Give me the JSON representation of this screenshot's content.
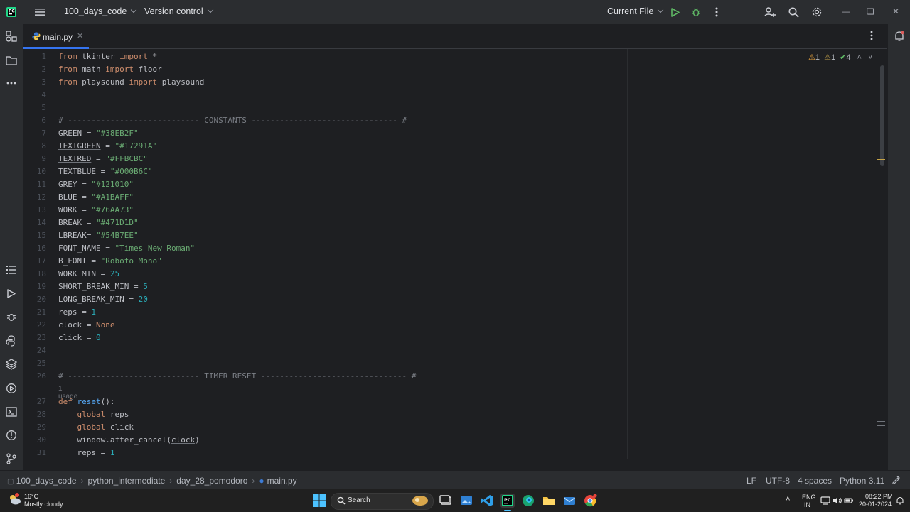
{
  "titlebar": {
    "project": "100_days_code",
    "vcs": "Version control",
    "run_config": "Current File"
  },
  "tab": {
    "label": "main.py"
  },
  "inspections": {
    "warnings_a": "1",
    "warnings_b": "1",
    "ok": "4"
  },
  "editor": {
    "line_numbers": [
      "1",
      "2",
      "3",
      "4",
      "5",
      "6",
      "7",
      "8",
      "9",
      "10",
      "11",
      "12",
      "13",
      "14",
      "15",
      "16",
      "17",
      "18",
      "19",
      "20",
      "21",
      "22",
      "23",
      "24",
      "25",
      "26",
      "27",
      "28",
      "29",
      "30",
      "31"
    ],
    "usage_hint": "1 usage",
    "code": {
      "l1_a": "from",
      "l1_b": " tkinter ",
      "l1_c": "import",
      "l1_d": " *",
      "l2_a": "from",
      "l2_b": " math ",
      "l2_c": "import",
      "l2_d": " floor",
      "l3_a": "from",
      "l3_b": " playsound ",
      "l3_c": "import",
      "l3_d": " playsound",
      "l6": "# ---------------------------- CONSTANTS ------------------------------- #",
      "l7_a": "GREEN = ",
      "l7_b": "\"#38EB2F\"",
      "l8_a": "TEXTGREEN",
      "l8_b": " = ",
      "l8_c": "\"#17291A\"",
      "l9_a": "TEXTRED",
      "l9_b": " = ",
      "l9_c": "\"#FFBCBC\"",
      "l10_a": "TEXTBLUE",
      "l10_b": " = ",
      "l10_c": "\"#000B6C\"",
      "l11_a": "GREY = ",
      "l11_b": "\"#121010\"",
      "l12_a": "BLUE = ",
      "l12_b": "\"#A1BAFF\"",
      "l13_a": "WORK = ",
      "l13_b": "\"#76AA73\"",
      "l14_a": "BREAK = ",
      "l14_b": "\"#471D1D\"",
      "l15_a": "LBREAK",
      "l15_b": "= ",
      "l15_c": "\"#54B7EE\"",
      "l16_a": "FONT_NAME = ",
      "l16_b": "\"Times New Roman\"",
      "l17_a": "B_FONT = ",
      "l17_b": "\"Roboto Mono\"",
      "l18_a": "WORK_MIN = ",
      "l18_b": "25",
      "l19_a": "SHORT_BREAK_MIN = ",
      "l19_b": "5",
      "l20_a": "LONG_BREAK_MIN = ",
      "l20_b": "20",
      "l21_a": "reps = ",
      "l21_b": "1",
      "l22_a": "clock = ",
      "l22_b": "None",
      "l23_a": "click = ",
      "l23_b": "0",
      "l26": "# ---------------------------- TIMER RESET ------------------------------- #",
      "l27_a": "def",
      "l27_b": " reset",
      "l27_c": "():",
      "l28_a": "    ",
      "l28_b": "global",
      "l28_c": " reps",
      "l29_a": "    ",
      "l29_b": "global",
      "l29_c": " click",
      "l30_a": "    window.after_cancel(",
      "l30_b": "clock",
      "l30_c": ")",
      "l31_a": "    reps = ",
      "l31_b": "1"
    }
  },
  "statusbar": {
    "crumbs": [
      "100_days_code",
      "python_intermediate",
      "day_28_pomodoro",
      "main.py"
    ],
    "line_sep": "LF",
    "encoding": "UTF-8",
    "indent": "4 spaces",
    "interpreter": "Python 3.11"
  },
  "taskbar": {
    "weather_temp": "16°C",
    "weather_desc": "Mostly cloudy",
    "search_label": "Search",
    "lang_top": "ENG",
    "lang_bottom": "IN",
    "time": "08:22 PM",
    "date": "20-01-2024"
  }
}
